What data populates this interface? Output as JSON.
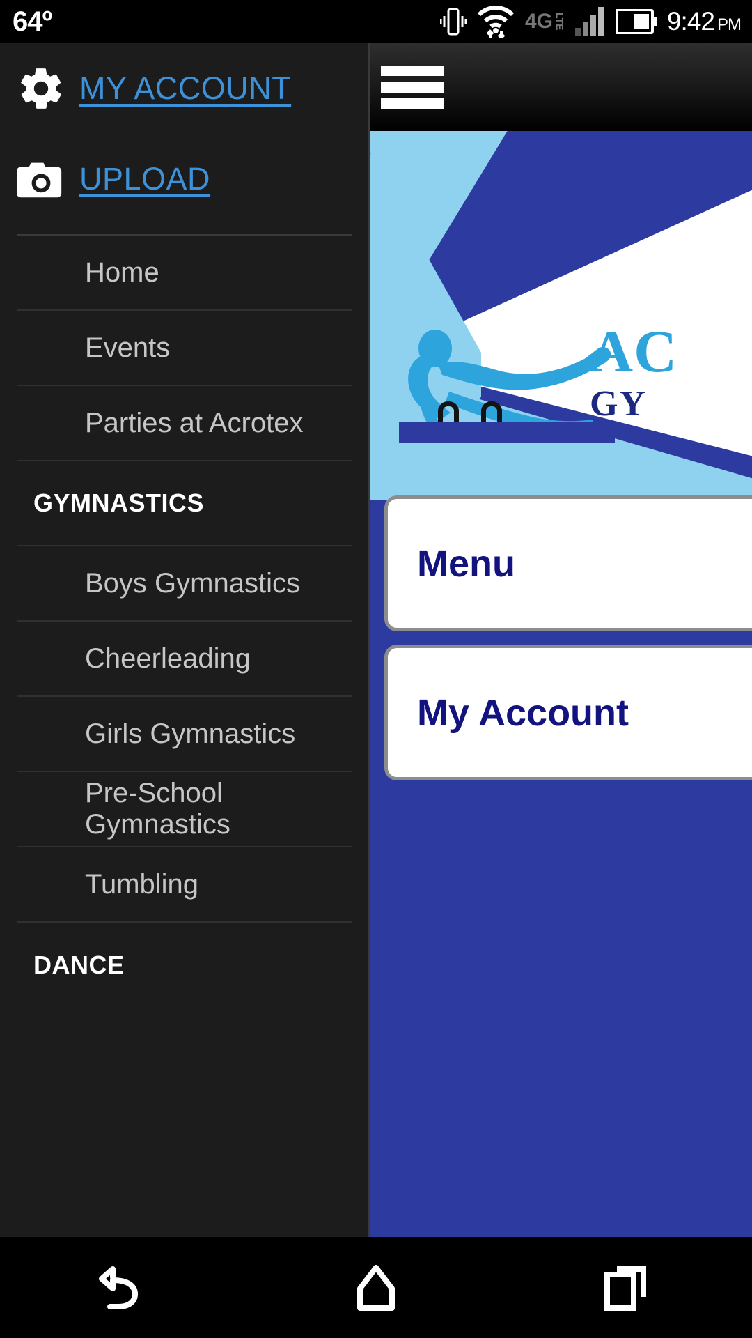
{
  "status_bar": {
    "temperature": "64º",
    "time": "9:42",
    "meridiem": "PM",
    "icons": [
      "vibrate-icon",
      "wifi-icon",
      "4g-lte-icon",
      "signal-bars-icon",
      "battery-icon"
    ],
    "network_label": "4G",
    "network_sub": "LTE"
  },
  "drawer": {
    "top_links": [
      {
        "icon": "gear-icon",
        "label": "MY ACCOUNT"
      },
      {
        "icon": "camera-icon",
        "label": "UPLOAD"
      }
    ],
    "items": [
      {
        "type": "item",
        "label": "Home"
      },
      {
        "type": "item",
        "label": "Events"
      },
      {
        "type": "item",
        "label": "Parties at Acrotex"
      },
      {
        "type": "heading",
        "label": "GYMNASTICS"
      },
      {
        "type": "item",
        "label": "Boys Gymnastics"
      },
      {
        "type": "item",
        "label": "Cheerleading"
      },
      {
        "type": "item",
        "label": "Girls Gymnastics"
      },
      {
        "type": "item",
        "label": "Pre-School Gymnastics"
      },
      {
        "type": "item",
        "label": "Tumbling"
      },
      {
        "type": "heading",
        "label": "DANCE"
      }
    ],
    "link_color": "#3d91d8",
    "item_color": "#c6c6c6",
    "background": "#1c1c1c"
  },
  "webview": {
    "hamburger_icon": "hamburger-menu-icon",
    "logo": {
      "alt": "Acrotex Gymnastics logo",
      "text_primary": "AC",
      "text_secondary": "GY",
      "colors": {
        "navy": "#2d3ba0",
        "light_blue": "#8fd2f0",
        "accent_blue": "#2ea4dd",
        "dark_navy": "#1b2a80",
        "white": "#ffffff"
      }
    },
    "buttons": [
      {
        "label": "Menu"
      },
      {
        "label": "My Account"
      }
    ],
    "button_text_color": "#12137e"
  },
  "navbar": {
    "buttons": [
      {
        "icon": "back-icon",
        "name": "back"
      },
      {
        "icon": "home-icon",
        "name": "home"
      },
      {
        "icon": "recents-icon",
        "name": "recents"
      }
    ]
  }
}
